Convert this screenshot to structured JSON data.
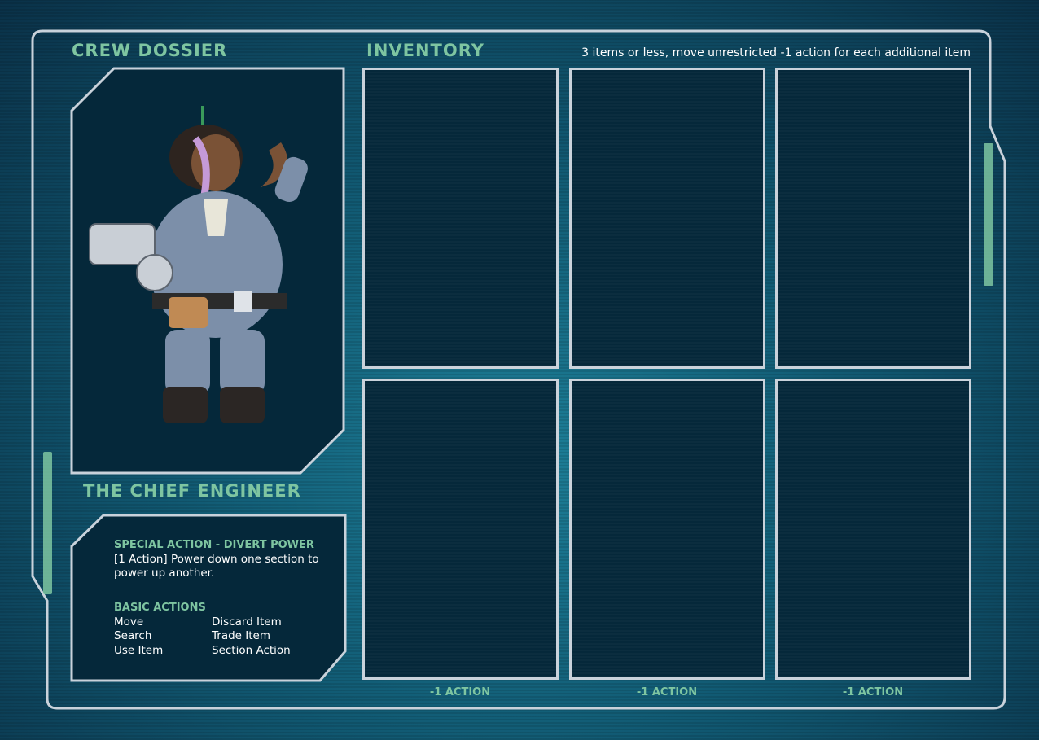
{
  "crew": {
    "title": "CREW DOSSIER",
    "character_name": "THE CHIEF ENGINEER",
    "portrait_icon": "chief-engineer-portrait"
  },
  "abilities": {
    "special_heading": "SPECIAL ACTION - DIVERT POWER",
    "special_text": "[1 Action] Power down one section to power up another.",
    "basic_heading": "BASIC ACTIONS",
    "basic_actions": [
      "Move",
      "Discard Item",
      "Search",
      "Trade Item",
      "Use Item",
      "Section Action"
    ]
  },
  "inventory": {
    "title": "INVENTORY",
    "note": "3 items or less, move unrestricted -1 action for each additional item",
    "penalty_labels": [
      "-1 ACTION",
      "-1 ACTION",
      "-1 ACTION"
    ]
  },
  "colors": {
    "accent_green": "#7ec5a1",
    "frame_border": "#c9d2db",
    "panel_fill": "#05283a",
    "background": "#115a73"
  }
}
